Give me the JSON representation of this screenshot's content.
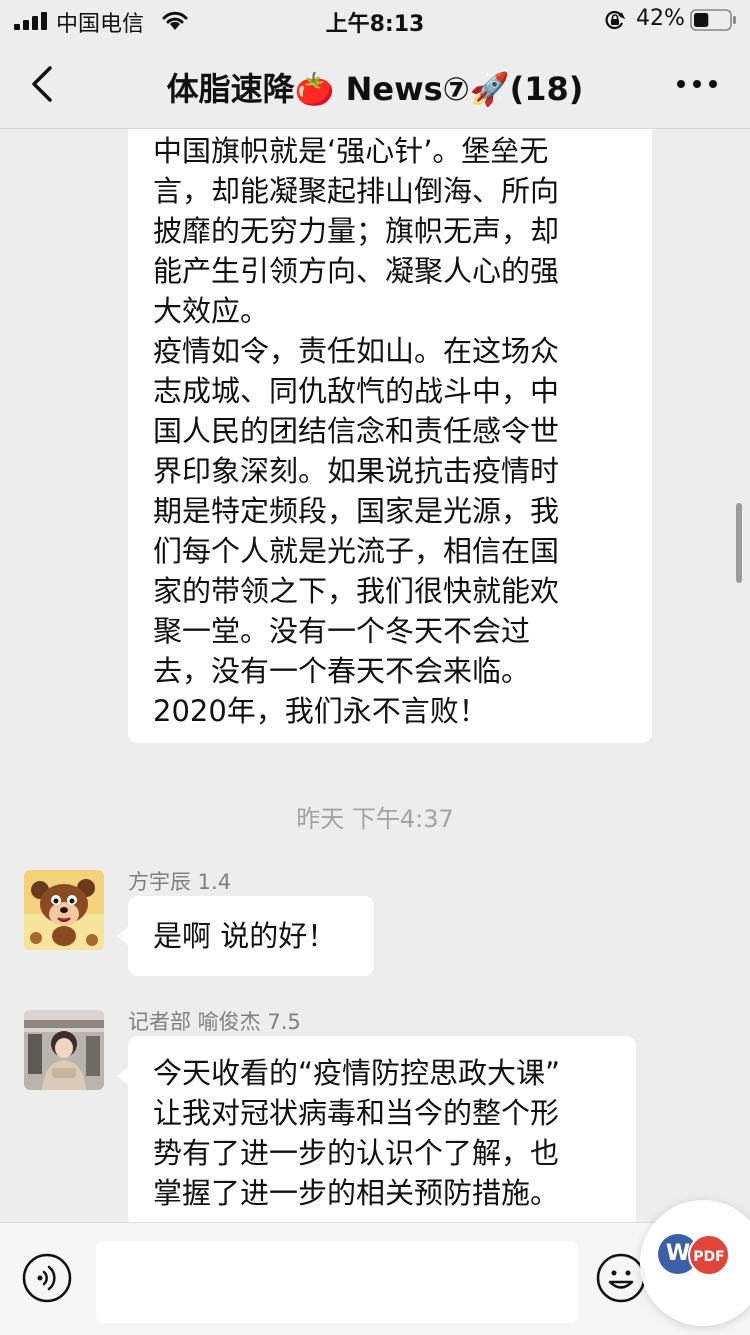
{
  "status_bar": {
    "carrier": "中国电信",
    "time": "上午8:13",
    "battery_percent": "42%",
    "battery_level": 0.42
  },
  "nav": {
    "title": "体脂速降🍅 News⑦🚀(18)"
  },
  "messages": {
    "long_message": {
      "lines": [
        "中国旗帜就是‘强心针’。堡垒无",
        "言，却能凝聚起排山倒海、所向",
        "披靡的无穷力量；旗帜无声，却",
        "能产生引领方向、凝聚人心的强",
        "大效应。",
        "疫情如令，责任如山。在这场众",
        "志成城、同仇敌忾的战斗中，中",
        "国人民的团结信念和责任感令世",
        "界印象深刻。如果说抗击疫情时",
        "期是特定频段，国家是光源，我",
        "们每个人就是光流子，相信在国",
        "家的带领之下，我们很快就能欢",
        "聚一堂。没有一个冬天不会过",
        "去，没有一个春天不会来临。",
        "2020年，我们永不言败！"
      ]
    },
    "timestamp": "昨天 下午4:37",
    "msg1": {
      "sender": "方宇辰 1.4",
      "text": "是啊 说的好！"
    },
    "msg2": {
      "sender": "记者部 喻俊杰 7.5",
      "lines": [
        "今天收看的“疫情防控思政大课”",
        "让我对冠状病毒和当今的整个形",
        "势有了进一步的认识个了解，也",
        "掌握了进一步的相关预防措施。"
      ]
    }
  },
  "input_bar": {
    "input_value": "",
    "widget_w": "W",
    "widget_pdf": "PDF"
  },
  "colors": {
    "background": "#ededed",
    "bubble": "#ffffff",
    "timestamp": "#a3a3a3",
    "sender": "#808080"
  }
}
